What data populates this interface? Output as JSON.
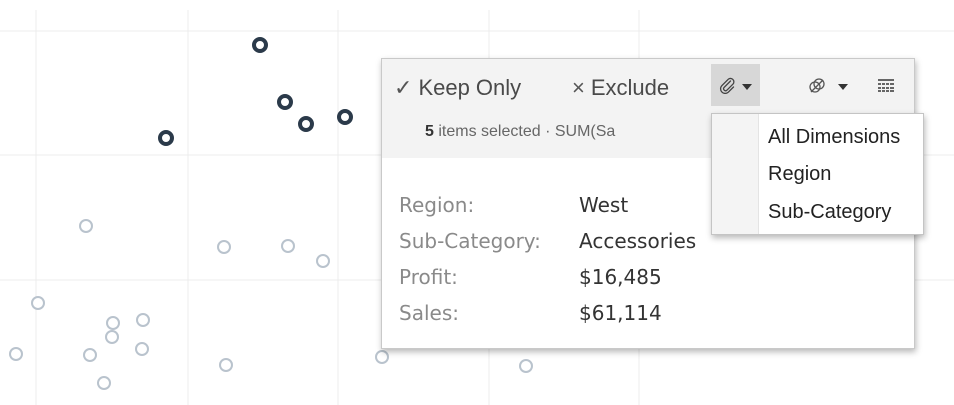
{
  "tooltip": {
    "keep_only_glyph": "✓",
    "keep_only_label": "Keep Only",
    "exclude_glyph": "×",
    "exclude_label": "Exclude",
    "group_icon": "paperclip-icon",
    "set_icon": "set-icon",
    "view_data_icon": "view-data-icon",
    "selected_count": "5",
    "selected_text": "items selected · SUM(Sa",
    "fields": [
      {
        "label": "Region:",
        "value": "West"
      },
      {
        "label": "Sub-Category:",
        "value": "Accessories"
      },
      {
        "label": "Profit:",
        "value": "$16,485"
      },
      {
        "label": "Sales:",
        "value": "$61,114"
      }
    ]
  },
  "group_menu": {
    "items": [
      "All Dimensions",
      "Region",
      "Sub-Category"
    ]
  },
  "chart_data": {
    "type": "scatter",
    "marks_total": 29,
    "selected_marks": 5,
    "selected_color": "#2b3a4a",
    "unselected_color": "#b9c3cd",
    "grid": true
  }
}
